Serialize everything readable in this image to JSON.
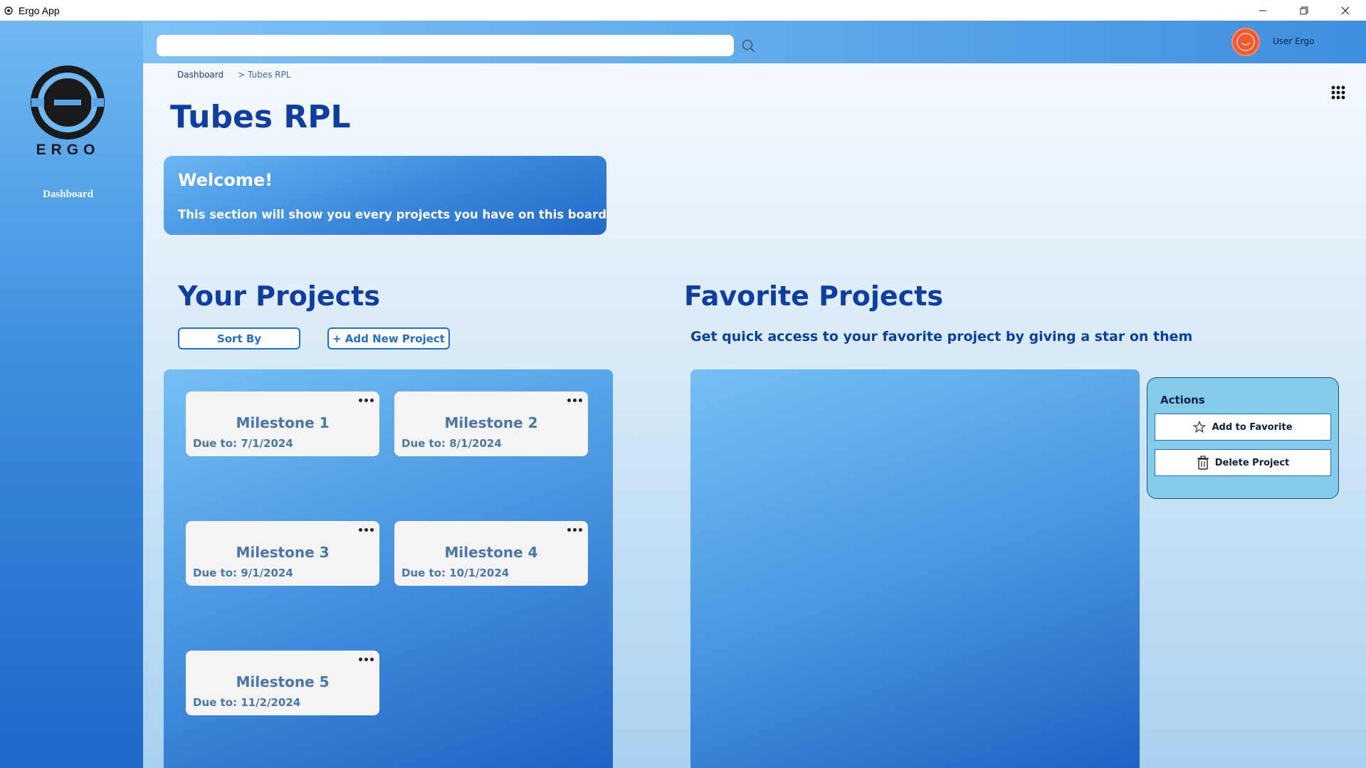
{
  "window": {
    "title": "Ergo App"
  },
  "sidebar": {
    "logo_text": "ERGO",
    "nav_items": [
      {
        "label": "Dashboard"
      }
    ]
  },
  "header": {
    "search": {
      "value": "",
      "placeholder": ""
    },
    "user_name": "User Ergo"
  },
  "breadcrumb": {
    "root": "Dashboard",
    "current": "> Tubes RPL"
  },
  "page": {
    "title": "Tubes RPL"
  },
  "welcome": {
    "title": "Welcome!",
    "text": "This section will show you every projects you have on this board"
  },
  "your_projects": {
    "title": "Your Projects",
    "sort_label": "Sort By",
    "add_label": "+ Add New Project",
    "projects": [
      {
        "name": "Milestone 1",
        "due": "Due to: 7/1/2024"
      },
      {
        "name": "Milestone 2",
        "due": "Due to: 8/1/2024"
      },
      {
        "name": "Milestone 3",
        "due": "Due to: 9/1/2024"
      },
      {
        "name": "Milestone 4",
        "due": "Due to: 10/1/2024"
      },
      {
        "name": "Milestone 5",
        "due": "Due to: 11/2/2024"
      }
    ]
  },
  "favorite_projects": {
    "title": "Favorite Projects",
    "subtitle": "Get quick access to your favorite project by giving a star on them"
  },
  "actions": {
    "title": "Actions",
    "add_favorite_label": "Add to Favorite",
    "delete_label": "Delete Project"
  },
  "colors": {
    "primary_text": "#0e3ea2",
    "accent": "#1f6fd0",
    "avatar": "#f05a2e",
    "card_text": "#4a77a8"
  },
  "icons": [
    "app-icon",
    "minimize-icon",
    "restore-icon",
    "close-icon",
    "search-icon",
    "avatar-smiley-icon",
    "grid-apps-icon",
    "more-dots-icon",
    "star-icon",
    "trash-icon"
  ]
}
